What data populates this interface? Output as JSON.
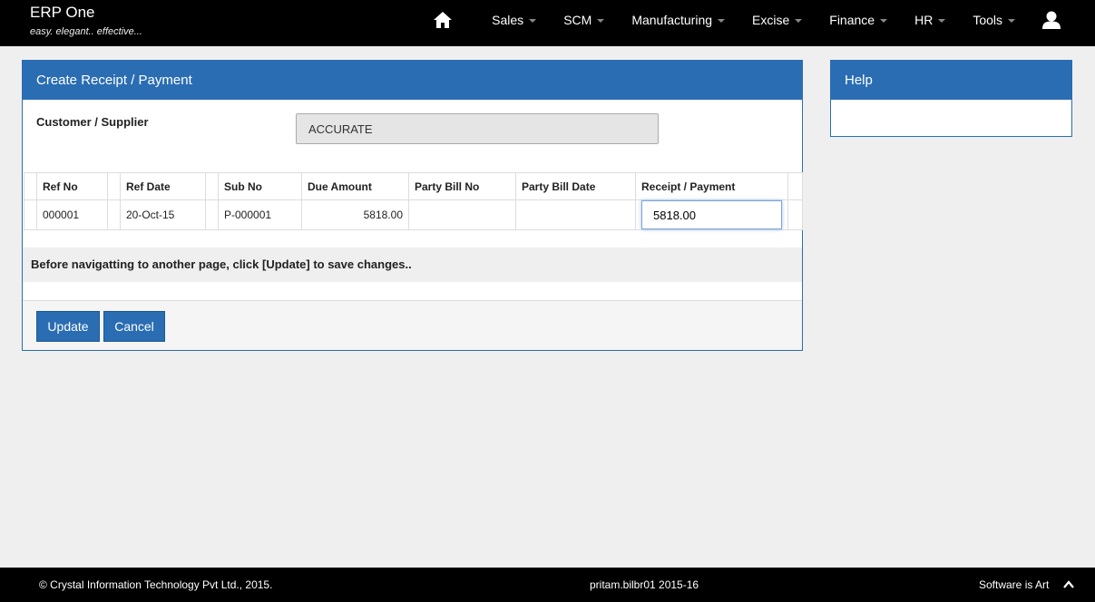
{
  "app": {
    "name": "ERP One",
    "tagline": "easy. elegant.. effective..."
  },
  "nav": {
    "items": [
      "Sales",
      "SCM",
      "Manufacturing",
      "Excise",
      "Finance",
      "HR",
      "Tools"
    ]
  },
  "form": {
    "title": "Create Receipt / Payment",
    "customer_label": "Customer / Supplier",
    "customer_value": "ACCURATE",
    "columns": [
      "Ref No",
      "Ref Date",
      "Sub No",
      "Due Amount",
      "Party Bill No",
      "Party Bill Date",
      "Receipt / Payment"
    ],
    "rows": [
      {
        "ref_no": "000001",
        "ref_date": "20-Oct-15",
        "sub_no": "P-000001",
        "due_amount": "5818.00",
        "party_bill_no": "",
        "party_bill_date": "",
        "receipt_payment": "5818.00"
      }
    ],
    "notice": "Before navigatting to another page, click [Update] to save changes..",
    "update_label": "Update",
    "cancel_label": "Cancel"
  },
  "help": {
    "title": "Help"
  },
  "footer": {
    "copyright": "© Crystal Information Technology Pvt Ltd., 2015.",
    "user": "pritam.bilbr01 2015-16",
    "slogan": "Software is Art"
  },
  "colors": {
    "primary": "#2a6db3",
    "topbar": "#000000",
    "background": "#efefef"
  }
}
